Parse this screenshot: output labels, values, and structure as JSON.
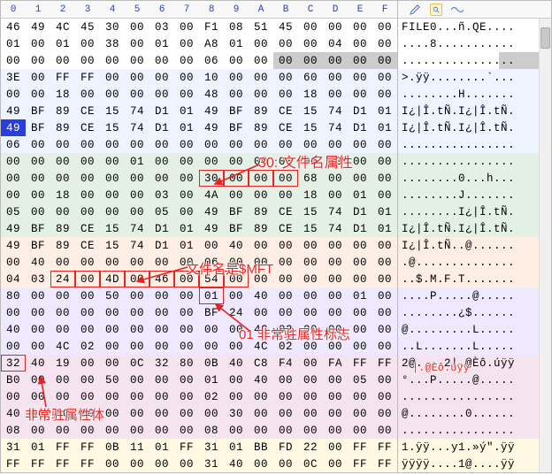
{
  "header": [
    "0",
    "1",
    "2",
    "3",
    "4",
    "5",
    "6",
    "7",
    "8",
    "9",
    "A",
    "B",
    "C",
    "D",
    "E",
    "F"
  ],
  "rows": [
    {
      "g": "g0",
      "hex": [
        "46",
        "49",
        "4C",
        "45",
        "30",
        "00",
        "03",
        "00",
        "F1",
        "08",
        "51",
        "45",
        "00",
        "00",
        "00",
        "00"
      ],
      "ascii": "FILE0...ñ.QE...."
    },
    {
      "g": "g0",
      "hex": [
        "01",
        "00",
        "01",
        "00",
        "38",
        "00",
        "01",
        "00",
        "A8",
        "01",
        "00",
        "00",
        "00",
        "04",
        "00",
        "00"
      ],
      "ascii": "....8..........."
    },
    {
      "g": "g0",
      "hex": [
        "00",
        "00",
        "00",
        "00",
        "00",
        "00",
        "00",
        "00",
        "06",
        "00",
        "00",
        "00",
        "00",
        "00",
        "00",
        "00"
      ],
      "ascii": "................"
    },
    {
      "g": "g1",
      "hex": [
        "3E",
        "00",
        "FF",
        "FF",
        "00",
        "00",
        "00",
        "00",
        "10",
        "00",
        "00",
        "00",
        "60",
        "00",
        "00",
        "00"
      ],
      "ascii": ">.ÿÿ........`..."
    },
    {
      "g": "g1",
      "hex": [
        "00",
        "00",
        "18",
        "00",
        "00",
        "00",
        "00",
        "00",
        "48",
        "00",
        "00",
        "00",
        "18",
        "00",
        "00",
        "00"
      ],
      "ascii": "........H......."
    },
    {
      "g": "g1",
      "hex": [
        "49",
        "BF",
        "89",
        "CE",
        "15",
        "74",
        "D1",
        "01",
        "49",
        "BF",
        "89",
        "CE",
        "15",
        "74",
        "D1",
        "01"
      ],
      "ascii": "I¿|Î.tÑ.I¿|Î.tÑ."
    },
    {
      "g": "g1",
      "hex": [
        "49",
        "BF",
        "89",
        "CE",
        "15",
        "74",
        "D1",
        "01",
        "49",
        "BF",
        "89",
        "CE",
        "15",
        "74",
        "D1",
        "01"
      ],
      "ascii": "I¿|Î.tÑ.I¿|Î.tÑ.",
      "selCol": 0
    },
    {
      "g": "g1",
      "hex": [
        "06",
        "00",
        "00",
        "00",
        "00",
        "00",
        "00",
        "00",
        "00",
        "00",
        "00",
        "00",
        "00",
        "00",
        "00",
        "00"
      ],
      "ascii": "................"
    },
    {
      "g": "g2",
      "hex": [
        "00",
        "00",
        "00",
        "00",
        "00",
        "01",
        "00",
        "00",
        "00",
        "00",
        "00",
        "00",
        "00",
        "00",
        "00",
        "00"
      ],
      "ascii": "................"
    },
    {
      "g": "g2",
      "hex": [
        "00",
        "00",
        "00",
        "00",
        "00",
        "00",
        "00",
        "00",
        "30",
        "00",
        "00",
        "00",
        "68",
        "00",
        "00",
        "00"
      ],
      "ascii": "........0...h...",
      "box1": {
        "start": 8,
        "end": 11
      }
    },
    {
      "g": "g2",
      "hex": [
        "00",
        "00",
        "18",
        "00",
        "00",
        "00",
        "03",
        "00",
        "4A",
        "00",
        "00",
        "00",
        "18",
        "00",
        "01",
        "00"
      ],
      "ascii": "........J......."
    },
    {
      "g": "g2",
      "hex": [
        "05",
        "00",
        "00",
        "00",
        "00",
        "00",
        "05",
        "00",
        "49",
        "BF",
        "89",
        "CE",
        "15",
        "74",
        "D1",
        "01"
      ],
      "ascii": "........I¿|Î.tÑ."
    },
    {
      "g": "g2",
      "hex": [
        "49",
        "BF",
        "89",
        "CE",
        "15",
        "74",
        "D1",
        "01",
        "49",
        "BF",
        "89",
        "CE",
        "15",
        "74",
        "D1",
        "01"
      ],
      "ascii": "I¿|Î.tÑ.I¿|Î.tÑ."
    },
    {
      "g": "g3",
      "hex": [
        "49",
        "BF",
        "89",
        "CE",
        "15",
        "74",
        "D1",
        "01",
        "00",
        "40",
        "00",
        "00",
        "00",
        "00",
        "00",
        "00"
      ],
      "ascii": "I¿|Î.tÑ..@......"
    },
    {
      "g": "g3",
      "hex": [
        "00",
        "40",
        "00",
        "00",
        "00",
        "00",
        "00",
        "00",
        "06",
        "00",
        "00",
        "00",
        "00",
        "00",
        "00",
        "00"
      ],
      "ascii": ".@.............."
    },
    {
      "g": "g3",
      "hex": [
        "04",
        "03",
        "24",
        "00",
        "4D",
        "00",
        "46",
        "00",
        "54",
        "00",
        "00",
        "00",
        "00",
        "00",
        "00",
        "00"
      ],
      "ascii": "..$.M.F.T.......",
      "box1": {
        "start": 2,
        "end": 9
      }
    },
    {
      "g": "g4",
      "hex": [
        "80",
        "00",
        "00",
        "00",
        "50",
        "00",
        "00",
        "00",
        "01",
        "00",
        "40",
        "00",
        "00",
        "00",
        "01",
        "00"
      ],
      "ascii": "....P.....@.....",
      "box1": {
        "start": 8,
        "end": 8
      }
    },
    {
      "g": "g4",
      "hex": [
        "00",
        "00",
        "00",
        "00",
        "00",
        "00",
        "00",
        "00",
        "BF",
        "24",
        "00",
        "00",
        "00",
        "00",
        "00",
        "00"
      ],
      "ascii": "........¿$......"
    },
    {
      "g": "g4",
      "hex": [
        "40",
        "00",
        "00",
        "00",
        "00",
        "00",
        "00",
        "00",
        "00",
        "00",
        "4C",
        "02",
        "00",
        "00",
        "00",
        "00"
      ],
      "ascii": "@.........L....."
    },
    {
      "g": "g4",
      "hex": [
        "00",
        "00",
        "4C",
        "02",
        "00",
        "00",
        "00",
        "00",
        "00",
        "00",
        "4C",
        "02",
        "00",
        "00",
        "00",
        "00"
      ],
      "ascii": "..L.......L....."
    },
    {
      "g": "g5",
      "hex": [
        "32",
        "40",
        "19",
        "00",
        "00",
        "0C",
        "32",
        "80",
        "0B",
        "40",
        "C8",
        "F4",
        "00",
        "FA",
        "FF",
        "FF"
      ],
      "ascii": "2@....2|.@Èô.úÿÿ",
      "box1": {
        "start": 0,
        "end": 0
      }
    },
    {
      "g": "g5",
      "hex": [
        "B0",
        "00",
        "00",
        "00",
        "50",
        "00",
        "00",
        "00",
        "01",
        "00",
        "40",
        "00",
        "00",
        "00",
        "05",
        "00"
      ],
      "ascii": "°...P.....@....."
    },
    {
      "g": "g5",
      "hex": [
        "00",
        "00",
        "00",
        "00",
        "00",
        "00",
        "00",
        "00",
        "02",
        "00",
        "00",
        "00",
        "00",
        "00",
        "00",
        "00"
      ],
      "ascii": "................"
    },
    {
      "g": "g5",
      "hex": [
        "40",
        "00",
        "00",
        "00",
        "00",
        "00",
        "00",
        "00",
        "00",
        "30",
        "00",
        "00",
        "00",
        "00",
        "00",
        "00"
      ],
      "ascii": "@........0......"
    },
    {
      "g": "g5",
      "hex": [
        "08",
        "00",
        "00",
        "00",
        "00",
        "00",
        "00",
        "00",
        "08",
        "00",
        "00",
        "00",
        "00",
        "00",
        "00",
        "00"
      ],
      "ascii": "................"
    },
    {
      "g": "g6",
      "hex": [
        "31",
        "01",
        "FF",
        "FF",
        "0B",
        "11",
        "01",
        "FF",
        "31",
        "01",
        "BB",
        "FD",
        "22",
        "00",
        "FF",
        "FF"
      ],
      "ascii": "1.ÿÿ...y1.»ý\".ÿÿ"
    },
    {
      "g": "g6",
      "hex": [
        "FF",
        "FF",
        "FF",
        "FF",
        "00",
        "00",
        "00",
        "00",
        "31",
        "40",
        "00",
        "00",
        "0C",
        "00",
        "FF",
        "FF"
      ],
      "ascii": "ÿÿÿÿ....1@....ÿÿ"
    }
  ],
  "annotations": {
    "a30": "30: 文件名属性",
    "mft": "文件名是$MFT",
    "flag": "01 非常驻属性标志",
    "body": "非常驻属性体",
    "eo": "|.@Èô.úÿÿ"
  },
  "chart_data": null
}
